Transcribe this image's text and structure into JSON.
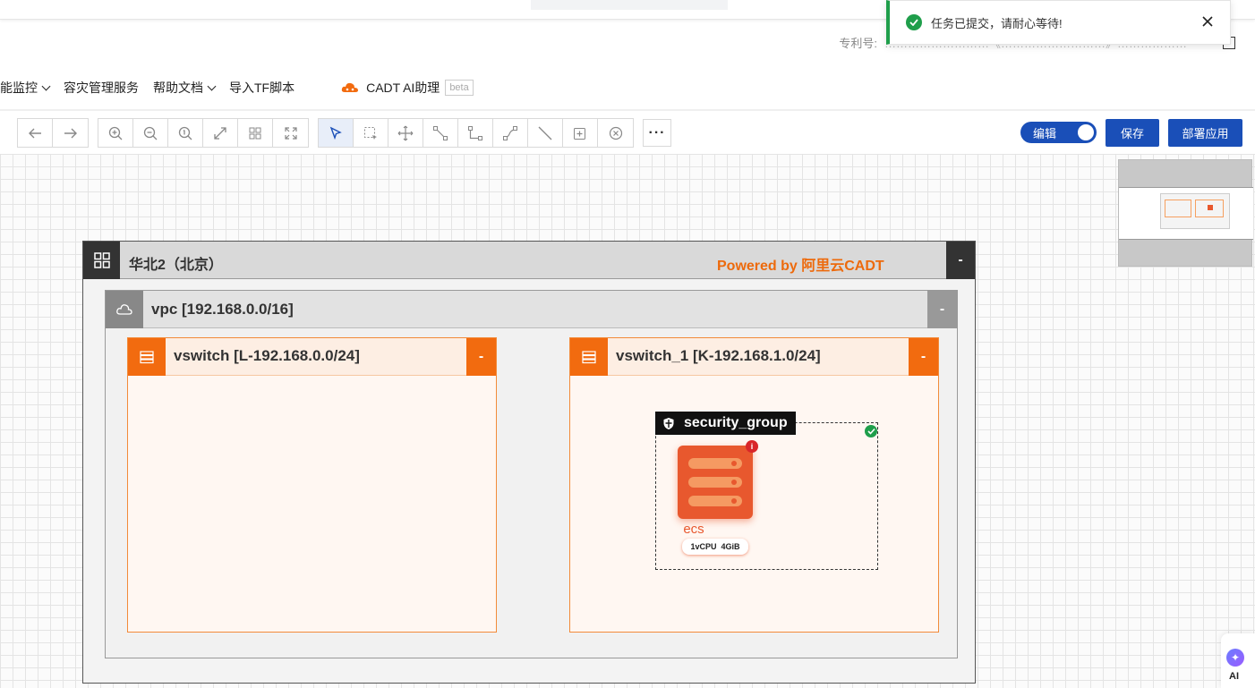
{
  "header": {
    "patent_label": "专利号:",
    "patent_value": "………………………《………………………》………………"
  },
  "menu": {
    "items": [
      {
        "label": "能监控",
        "has_dropdown": true
      },
      {
        "label": "容灾管理服务",
        "has_dropdown": false
      },
      {
        "label": "帮助文档",
        "has_dropdown": true
      },
      {
        "label": "导入TF脚本",
        "has_dropdown": false
      }
    ],
    "ai_label": "CADT AI助理",
    "beta": "beta"
  },
  "toolbar": {
    "history": [
      "undo-icon",
      "redo-icon"
    ],
    "view": [
      "zoom-in-icon",
      "zoom-out-icon",
      "zoom-reset-icon",
      "fit-icon",
      "grid-icon",
      "fullscreen-icon"
    ],
    "tools": [
      "select-icon",
      "marquee-icon",
      "pan-icon",
      "connector-icon",
      "elbow-icon",
      "curve-icon",
      "line-icon",
      "add-node-icon",
      "delete-icon"
    ],
    "more": "···",
    "toggle_label": "编辑",
    "save_label": "保存",
    "deploy_label": "部署应用"
  },
  "toast": {
    "message": "任务已提交，请耐心等待!",
    "status_color": "#1f9e4b"
  },
  "diagram": {
    "region_title": "华北2（北京）",
    "powered_by": "Powered by 阿里云CADT",
    "collapse": "-",
    "vpc_title": "vpc [192.168.0.0/16]",
    "vswitches": [
      {
        "title": "vswitch [L-192.168.0.0/24]"
      },
      {
        "title": "vswitch_1 [K-192.168.1.0/24]"
      }
    ],
    "security_group": "security_group",
    "ecs": {
      "name": "ecs",
      "cpu": "1vCPU",
      "mem": "4GiB",
      "info_badge": "i"
    },
    "accent_color": "#f26b0f"
  },
  "ai_float": {
    "label": "AI"
  }
}
